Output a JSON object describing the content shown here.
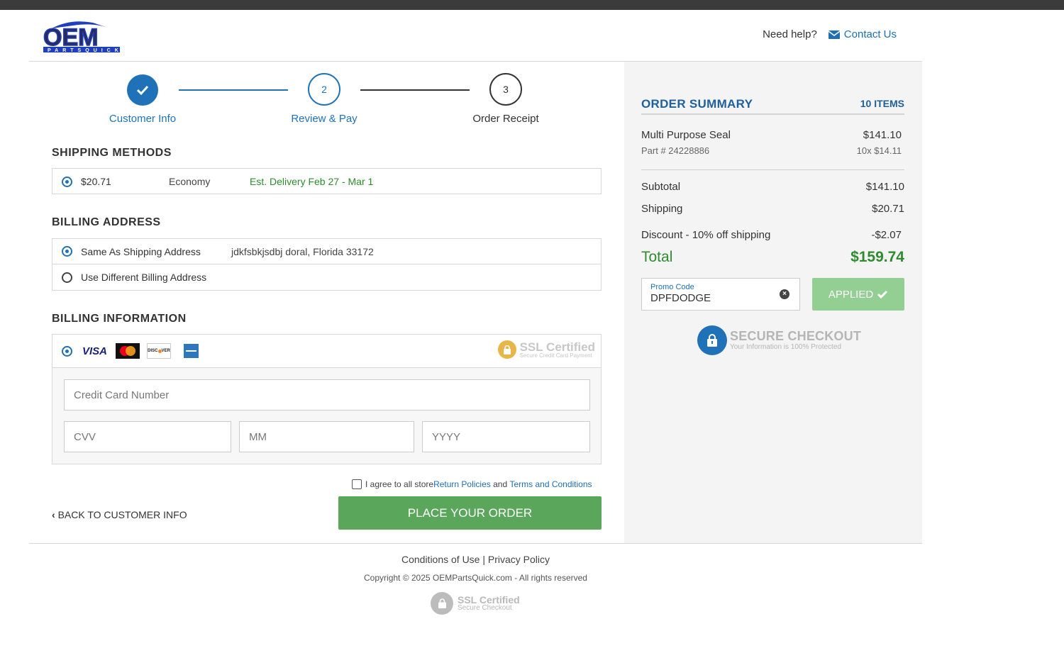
{
  "header": {
    "need_help": "Need help?",
    "contact": "Contact Us"
  },
  "steps": [
    {
      "num": "",
      "label": "Customer Info"
    },
    {
      "num": "2",
      "label": "Review & Pay"
    },
    {
      "num": "3",
      "label": "Order Receipt"
    }
  ],
  "shipping": {
    "title": "SHIPPING METHODS",
    "price": "$20.71",
    "method": "Economy",
    "delivery": "Est. Delivery Feb 27 - Mar 1"
  },
  "billing_address": {
    "title": "BILLING ADDRESS",
    "same_label": "Same As Shipping Address",
    "address": "jdkfsbkjsdbj doral, Florida 33172",
    "different_label": "Use Different Billing Address"
  },
  "billing_info": {
    "title": "BILLING INFORMATION",
    "ssl_title": "SSL Certified",
    "ssl_sub": "Secure Credit Card Payment",
    "card_placeholder": "Credit Card Number",
    "cvv_placeholder": "CVV",
    "mm_placeholder": "MM",
    "yyyy_placeholder": "YYYY"
  },
  "agree": {
    "prefix": "I agree to all store ",
    "return_link": "Return Policies",
    "and": " and ",
    "terms_link": "Terms and Conditions"
  },
  "actions": {
    "back": "BACK TO CUSTOMER INFO",
    "place": "PLACE YOUR ORDER"
  },
  "summary": {
    "title": "ORDER SUMMARY",
    "count": "10 ITEMS",
    "item_name": "Multi Purpose Seal",
    "item_price": "$141.10",
    "item_part": "Part # 24228886",
    "item_qty": "10x $14.11",
    "subtotal_label": "Subtotal",
    "subtotal": "$141.10",
    "shipping_label": "Shipping",
    "shipping": "$20.71",
    "discount_label": "Discount - 10% off shipping",
    "discount": "-$2.07",
    "total_label": "Total",
    "total": "$159.74",
    "promo_label": "Promo Code",
    "promo_value": "DPFDODGE",
    "applied": "APPLIED",
    "secure_title": "SECURE CHECKOUT",
    "secure_sub": "Your Information is 100% Protected"
  },
  "footer": {
    "links": "Conditions of Use | Privacy Policy",
    "copyright": "Copyright © 2025 OEMPartsQuick.com - All rights reserved",
    "ssl_title": "SSL Certified",
    "ssl_sub": "Secure Checkout"
  },
  "colors": {
    "brand_blue": "#1f72b8",
    "green": "#5aa65a",
    "total_green": "#2e8b2e"
  }
}
